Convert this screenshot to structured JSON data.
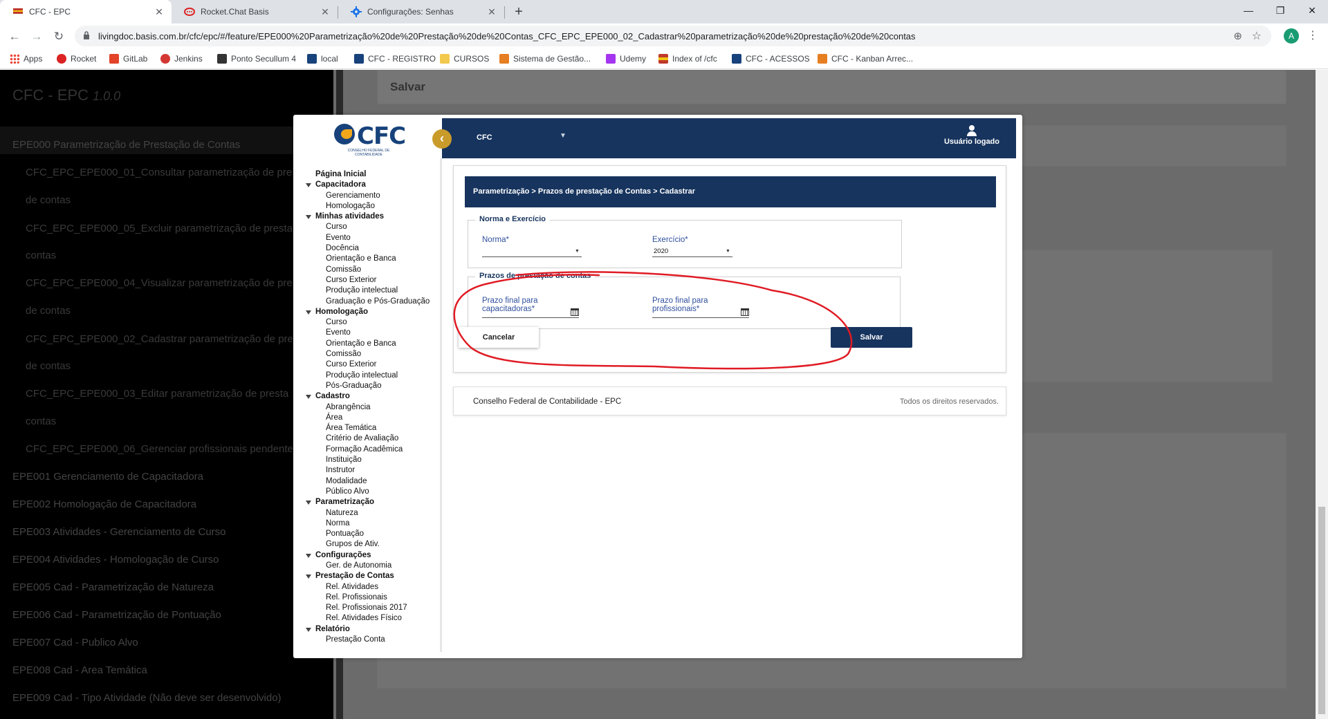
{
  "browser": {
    "tabs": [
      {
        "title": "CFC - EPC",
        "active": true
      },
      {
        "title": "Rocket.Chat Basis",
        "active": false
      },
      {
        "title": "Configurações: Senhas",
        "active": false
      }
    ],
    "tab_close": "✕",
    "new_tab": "+",
    "window_controls": {
      "minimize": "—",
      "maximize": "❐",
      "close": "✕"
    },
    "nav": {
      "back": "←",
      "forward": "→",
      "reload": "↻"
    },
    "url": "livingdoc.basis.com.br/cfc/epc/#/feature/EPE000%20Parametrização%20de%20Prestação%20de%20Contas_CFC_EPC_EPE000_02_Cadastrar%20parametrização%20de%20prestação%20de%20contas",
    "zoom_icon": "⊕",
    "star_icon": "☆",
    "profile_initial": "A",
    "menu_icon": "⋮",
    "bookmarks": [
      {
        "label": "Apps",
        "color": "#4285f4"
      },
      {
        "label": "Rocket",
        "color": "#db2323"
      },
      {
        "label": "GitLab",
        "color": "#e24329"
      },
      {
        "label": "Jenkins",
        "color": "#d33833"
      },
      {
        "label": "Ponto Secullum 4",
        "color": "#333333"
      },
      {
        "label": "local",
        "color": "#17427b"
      },
      {
        "label": "CFC - REGISTRO",
        "color": "#17427b"
      },
      {
        "label": "CURSOS",
        "color": "#f2c94c"
      },
      {
        "label": "Sistema de Gestão...",
        "color": "#e67e22"
      },
      {
        "label": "Udemy",
        "color": "#a435f0"
      },
      {
        "label": "Index of /cfc",
        "color": "#c0392b"
      },
      {
        "label": "CFC - ACESSOS",
        "color": "#17427b"
      },
      {
        "label": "CFC - Kanban Arrec...",
        "color": "#e67e22"
      }
    ]
  },
  "background_page": {
    "brand": "CFC - EPC",
    "version": "1.0.0",
    "panel_title": "Salvar",
    "nav": [
      {
        "label": "EPE000 Parametrização de Prestação de Contas",
        "sub": false
      },
      {
        "label": "CFC_EPC_EPE000_01_Consultar parametrização de pre",
        "sub": true
      },
      {
        "label": "de contas",
        "sub": true
      },
      {
        "label": "CFC_EPC_EPE000_05_Excluir parametrização de presta",
        "sub": true
      },
      {
        "label": "contas",
        "sub": true
      },
      {
        "label": "CFC_EPC_EPE000_04_Visualizar parametrização de pre",
        "sub": true
      },
      {
        "label": "de contas",
        "sub": true
      },
      {
        "label": "CFC_EPC_EPE000_02_Cadastrar parametrização de pre",
        "sub": true
      },
      {
        "label": "de contas",
        "sub": true
      },
      {
        "label": "CFC_EPC_EPE000_03_Editar parametrização de presta",
        "sub": true
      },
      {
        "label": "contas",
        "sub": true
      },
      {
        "label": "CFC_EPC_EPE000_06_Gerenciar profissionais pendente",
        "sub": true
      },
      {
        "label": "EPE001 Gerenciamento de Capacitadora",
        "sub": false
      },
      {
        "label": "EPE002 Homologação de Capacitadora",
        "sub": false
      },
      {
        "label": "EPE003 Atividades - Gerenciamento de Curso",
        "sub": false
      },
      {
        "label": "EPE004 Atividades - Homologação de Curso",
        "sub": false
      },
      {
        "label": "EPE005 Cad - Parametrização de Natureza",
        "sub": false
      },
      {
        "label": "EPE006 Cad - Parametrização de Pontuação",
        "sub": false
      },
      {
        "label": "EPE007 Cad - Publico Alvo",
        "sub": false
      },
      {
        "label": "EPE008 Cad - Area Temática",
        "sub": false
      },
      {
        "label": "EPE009 Cad - Tipo Atividade (Não deve ser desenvolvido)",
        "sub": false
      }
    ]
  },
  "app": {
    "logo_text": "CFC",
    "logo_subtitle": "CONSELHO FEDERAL DE CONTABILIDADE",
    "collapse_icon": "‹",
    "org_select": "CFC",
    "org_caret": "▼",
    "user_label": "Usuário logado",
    "sidebar": [
      {
        "type": "top",
        "label": "Página Inicial"
      },
      {
        "type": "group",
        "label": "Capacitadora",
        "items": [
          "Gerenciamento",
          "Homologação"
        ]
      },
      {
        "type": "group",
        "label": "Minhas atividades",
        "items": [
          "Curso",
          "Evento",
          "Docência",
          "Orientação e Banca",
          "Comissão",
          "Curso Exterior",
          "Produção intelectual",
          "Graduação e Pós-Graduação"
        ]
      },
      {
        "type": "group",
        "label": "Homologação",
        "items": [
          "Curso",
          "Evento",
          "Orientação e Banca",
          "Comissão",
          "Curso Exterior",
          "Produção intelectual",
          "Pós-Graduação"
        ]
      },
      {
        "type": "group",
        "label": "Cadastro",
        "items": [
          "Abrangência",
          "Área",
          "Área Temática",
          "Critério de Avaliação",
          "Formação Acadêmica",
          "Instituição",
          "Instrutor",
          "Modalidade",
          "Público Alvo"
        ]
      },
      {
        "type": "group",
        "label": "Parametrização",
        "items": [
          "Natureza",
          "Norma",
          "Pontuação",
          "Grupos de Ativ."
        ]
      },
      {
        "type": "group",
        "label": "Configurações",
        "items": [
          "Ger. de Autonomia"
        ]
      },
      {
        "type": "group",
        "label": "Prestação de Contas",
        "items": [
          "Rel. Atividades",
          "Rel. Profissionais",
          "Rel. Profissionais 2017",
          "Rel. Atividades Físico"
        ]
      },
      {
        "type": "group",
        "label": "Relatório",
        "items": [
          "Prestação Conta"
        ]
      }
    ],
    "breadcrumb": "Parametrização > Prazos de prestação de Contas > Cadastrar",
    "fieldset1": {
      "legend": "Norma e Exercício",
      "norma_label": "Norma*",
      "norma_value": "",
      "exercicio_label": "Exercício*",
      "exercicio_value": "2020"
    },
    "fieldset2": {
      "legend": "Prazos de prestação de contas",
      "capacitadoras_label": "Prazo final para capacitadoras*",
      "profissionais_label": "Prazo final para profissionais*"
    },
    "cancel_label": "Cancelar",
    "save_label": "Salvar",
    "footer_left": "Conselho Federal de Contabilidade - EPC",
    "footer_right": "Todos os direitos reservados."
  },
  "colors": {
    "navy": "#17345e",
    "gold": "#c99b2b",
    "annotation": "#e01b24"
  }
}
